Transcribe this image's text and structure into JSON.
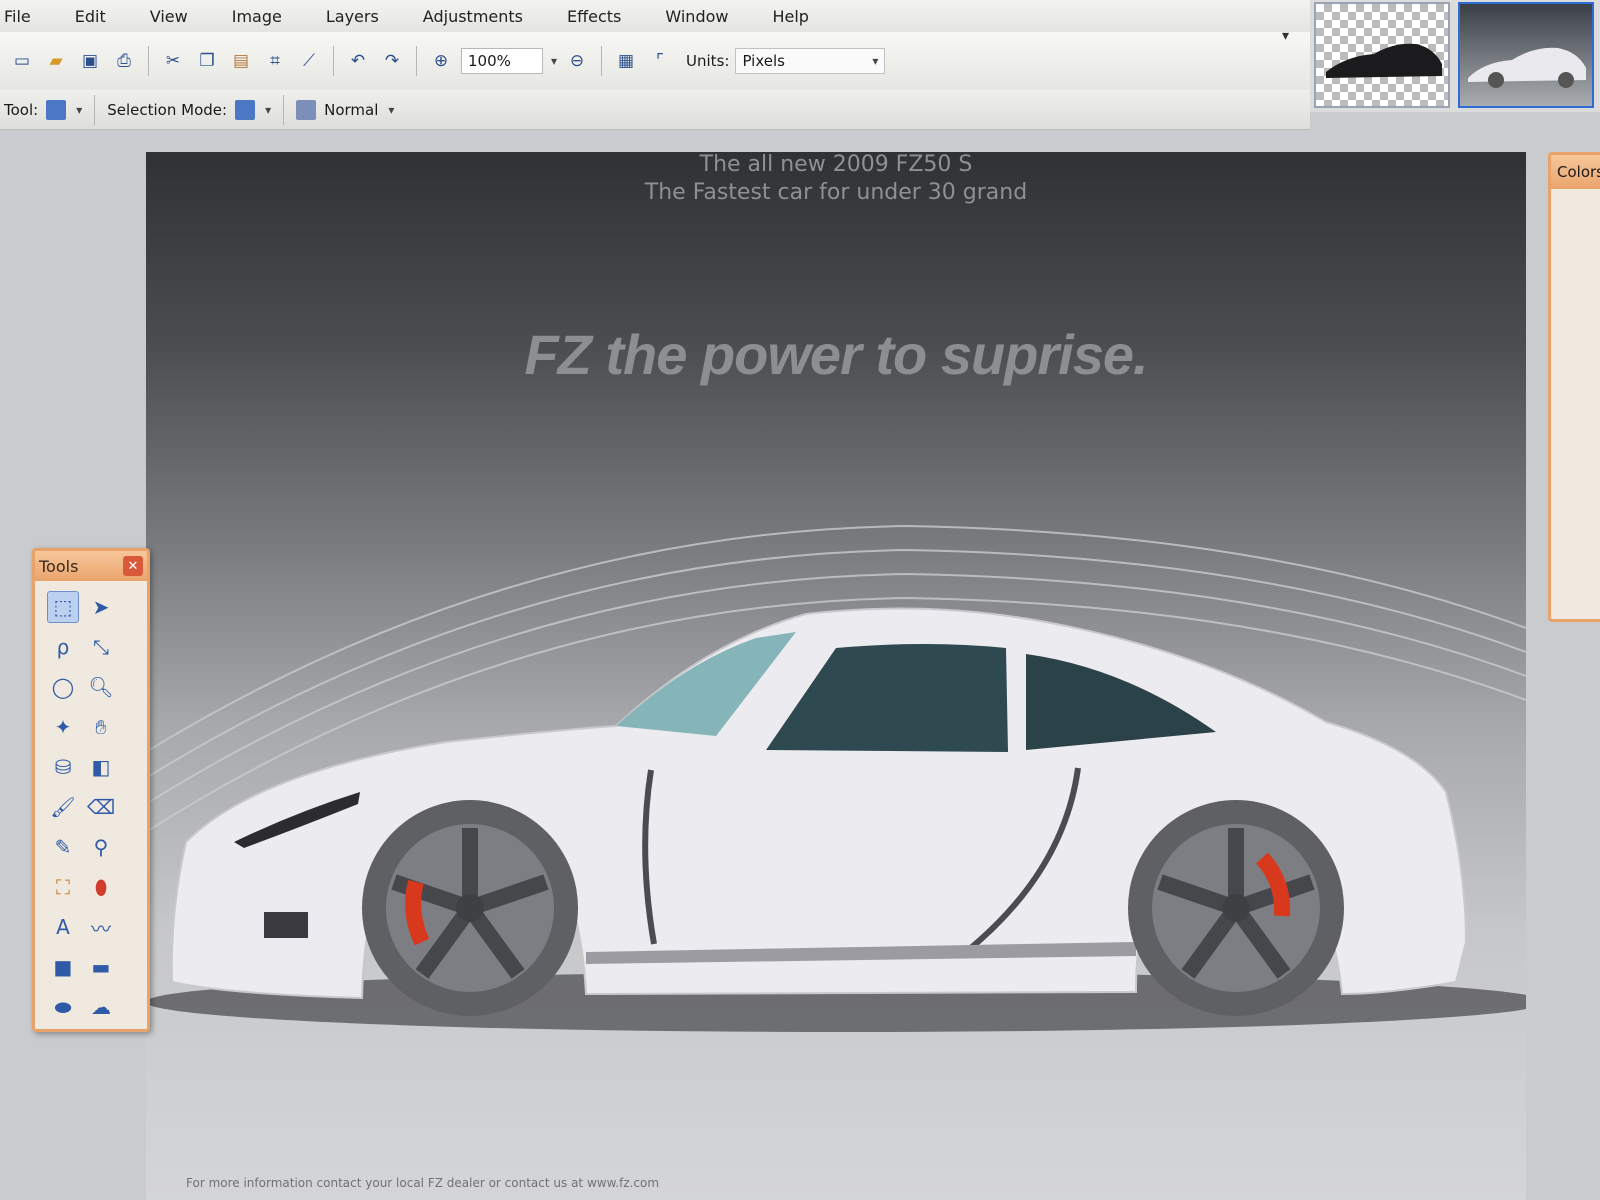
{
  "menubar": {
    "items": [
      {
        "label": "File"
      },
      {
        "label": "Edit"
      },
      {
        "label": "View"
      },
      {
        "label": "Image"
      },
      {
        "label": "Layers"
      },
      {
        "label": "Adjustments"
      },
      {
        "label": "Effects"
      },
      {
        "label": "Window"
      },
      {
        "label": "Help"
      }
    ]
  },
  "toolbar": {
    "zoom_value": "100%",
    "units_label": "Units:",
    "units_value": "Pixels"
  },
  "optionsbar": {
    "tool_label": "Tool:",
    "selection_mode_label": "Selection Mode:",
    "blend_mode_value": "Normal"
  },
  "tools_window": {
    "title": "Tools",
    "icons": [
      "rectangle-select-icon",
      "move-selection-icon",
      "lasso-select-icon",
      "move-selection-alt-icon",
      "ellipse-select-icon",
      "zoom-icon",
      "magic-wand-icon",
      "pan-hand-icon",
      "paint-bucket-icon",
      "gradient-icon",
      "paintbrush-icon",
      "eraser-icon",
      "pencil-icon",
      "color-picker-icon",
      "clone-stamp-icon",
      "recolor-icon",
      "text-icon",
      "line-curve-icon",
      "rectangle-icon",
      "rounded-rectangle-icon",
      "ellipse-icon",
      "freeform-shape-icon"
    ]
  },
  "right_panel": {
    "title": "Colors"
  },
  "canvas": {
    "headline_line1": "The all new 2009 FZ50 S",
    "headline_line2": "The Fastest car for under 30 grand",
    "tagline": "FZ the power to suprise.",
    "footer": "For more information contact your local FZ dealer or contact us at www.fz.com",
    "colors": {
      "car_body": "#ecebf0",
      "brake_caliper": "#d8381c",
      "window_tint": "#2e4a50"
    }
  }
}
